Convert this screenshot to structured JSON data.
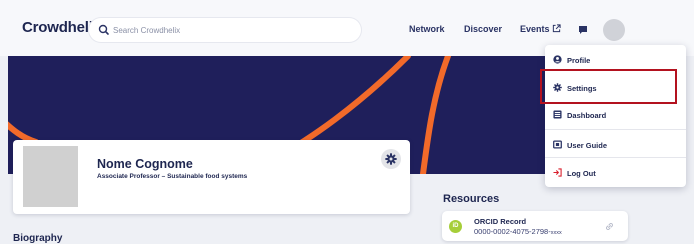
{
  "navbar": {
    "logo": "Crowdhelix",
    "search_placeholder": "Search Crowdhelix",
    "links": {
      "network": "Network",
      "discover": "Discover",
      "events": "Events"
    }
  },
  "profile": {
    "name": "Nome Cognome",
    "title": "Associate Professor – Sustainable food systems"
  },
  "sections": {
    "resources": "Resources",
    "biography": "Biography"
  },
  "orcid": {
    "label": "ORCID Record",
    "id_prefix": "0000-0002-4075-2798-",
    "id_masked": "xxxx",
    "logo_text": "iD"
  },
  "dropdown": {
    "items": {
      "profile": "Profile",
      "settings": "Settings",
      "dashboard": "Dashboard",
      "user_guide": "User Guide",
      "logout": "Log Out"
    }
  },
  "colors": {
    "navy": "#1e2650",
    "banner": "#1f1f5b",
    "accent_orange": "#f26a2a",
    "highlight_red": "#b3121f",
    "orcid_green": "#a6ce39"
  }
}
